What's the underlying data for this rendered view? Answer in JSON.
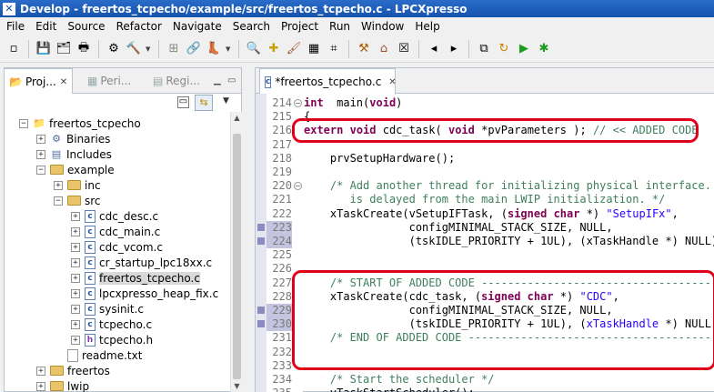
{
  "window": {
    "title": "Develop - freertos_tcpecho/example/src/freertos_tcpecho.c - LPCXpresso"
  },
  "menu": [
    "File",
    "Edit",
    "Source",
    "Refactor",
    "Navigate",
    "Search",
    "Project",
    "Run",
    "Window",
    "Help"
  ],
  "toolbar_icons": [
    "new-icon",
    "save-icon",
    "save-all-icon",
    "print-icon",
    "gear-icon",
    "hammer-icon",
    "binary-icon",
    "link-icon",
    "boot-icon",
    "search-icon",
    "new-project-icon",
    "brush-icon",
    "chip-icon",
    "xml-icon",
    "build-icon",
    "home-icon",
    "close-x-icon",
    "back-icon",
    "forward-icon",
    "copy-icon",
    "refresh-icon",
    "run-icon",
    "debug-icon"
  ],
  "left_panel": {
    "tabs": [
      {
        "label": "Proj...",
        "active": true
      },
      {
        "label": "Peri...",
        "active": false
      },
      {
        "label": "Regi...",
        "active": false
      }
    ],
    "tree": [
      {
        "label": "freertos_tcpecho",
        "depth": 0,
        "toggle": "-",
        "icon": "project"
      },
      {
        "label": "Binaries",
        "depth": 1,
        "toggle": "+",
        "icon": "binaries"
      },
      {
        "label": "Includes",
        "depth": 1,
        "toggle": "+",
        "icon": "includes"
      },
      {
        "label": "example",
        "depth": 1,
        "toggle": "-",
        "icon": "folder"
      },
      {
        "label": "inc",
        "depth": 2,
        "toggle": "+",
        "icon": "folder"
      },
      {
        "label": "src",
        "depth": 2,
        "toggle": "-",
        "icon": "folder"
      },
      {
        "label": "cdc_desc.c",
        "depth": 3,
        "toggle": "+",
        "icon": "c"
      },
      {
        "label": "cdc_main.c",
        "depth": 3,
        "toggle": "+",
        "icon": "c"
      },
      {
        "label": "cdc_vcom.c",
        "depth": 3,
        "toggle": "+",
        "icon": "c"
      },
      {
        "label": "cr_startup_lpc18xx.c",
        "depth": 3,
        "toggle": "+",
        "icon": "c"
      },
      {
        "label": "freertos_tcpecho.c",
        "depth": 3,
        "toggle": "+",
        "icon": "c",
        "selected": true
      },
      {
        "label": "lpcxpresso_heap_fix.c",
        "depth": 3,
        "toggle": "+",
        "icon": "c"
      },
      {
        "label": "sysinit.c",
        "depth": 3,
        "toggle": "+",
        "icon": "c"
      },
      {
        "label": "tcpecho.c",
        "depth": 3,
        "toggle": "+",
        "icon": "c"
      },
      {
        "label": "tcpecho.h",
        "depth": 3,
        "toggle": "+",
        "icon": "h"
      },
      {
        "label": "readme.txt",
        "depth": 2,
        "toggle": "",
        "icon": "txt"
      },
      {
        "label": "freertos",
        "depth": 1,
        "toggle": "+",
        "icon": "folder"
      },
      {
        "label": "lwip",
        "depth": 1,
        "toggle": "+",
        "icon": "folder"
      }
    ]
  },
  "editor": {
    "tab": {
      "label": "*freertos_tcpecho.c"
    },
    "lines": [
      {
        "num": "214",
        "fold": "-",
        "changed": false,
        "parts": [
          [
            "kw",
            "int"
          ],
          [
            "",
            "  main("
          ],
          [
            "kw",
            "void"
          ],
          [
            "",
            ")"
          ]
        ]
      },
      {
        "num": "215",
        "fold": "",
        "changed": false,
        "parts": [
          [
            "",
            "{"
          ]
        ]
      },
      {
        "num": "216",
        "fold": "",
        "changed": false,
        "parts": [
          [
            "kw",
            "extern"
          ],
          [
            "",
            " "
          ],
          [
            "kw",
            "void"
          ],
          [
            "",
            " cdc_task( "
          ],
          [
            "kw",
            "void"
          ],
          [
            "",
            " *pvParameters ); "
          ],
          [
            "cm",
            "// << ADDED CODE"
          ]
        ]
      },
      {
        "num": "217",
        "fold": "",
        "changed": false,
        "parts": [
          [
            "",
            ""
          ]
        ]
      },
      {
        "num": "218",
        "fold": "",
        "changed": false,
        "parts": [
          [
            "",
            "    prvSetupHardware();"
          ]
        ]
      },
      {
        "num": "219",
        "fold": "",
        "changed": false,
        "parts": [
          [
            "",
            ""
          ]
        ]
      },
      {
        "num": "220",
        "fold": "-",
        "changed": false,
        "parts": [
          [
            "cm",
            "    /* Add another thread for initializing physical interface. Th"
          ]
        ]
      },
      {
        "num": "221",
        "fold": "",
        "changed": false,
        "parts": [
          [
            "cm",
            "       is delayed from the main LWIP initialization. */"
          ]
        ]
      },
      {
        "num": "222",
        "fold": "",
        "changed": false,
        "parts": [
          [
            "",
            "    xTaskCreate(vSetupIFTask, ("
          ],
          [
            "kw",
            "signed"
          ],
          [
            "",
            " "
          ],
          [
            "kw",
            "char"
          ],
          [
            "",
            " *) "
          ],
          [
            "st",
            "\"SetupIFx\""
          ],
          [
            "",
            ","
          ]
        ]
      },
      {
        "num": "223",
        "fold": "",
        "changed": true,
        "parts": [
          [
            "",
            "                configMINIMAL_STACK_SIZE, NULL,"
          ]
        ]
      },
      {
        "num": "224",
        "fold": "",
        "changed": true,
        "parts": [
          [
            "",
            "                (tskIDLE_PRIORITY + 1UL), (xTaskHandle *) NULL);"
          ]
        ]
      },
      {
        "num": "225",
        "fold": "",
        "changed": false,
        "parts": [
          [
            "",
            ""
          ]
        ]
      },
      {
        "num": "226",
        "fold": "",
        "changed": false,
        "parts": [
          [
            "",
            ""
          ]
        ]
      },
      {
        "num": "227",
        "fold": "",
        "changed": false,
        "parts": [
          [
            "cm",
            "    /* START OF ADDED CODE -----------------------------------------"
          ]
        ]
      },
      {
        "num": "228",
        "fold": "",
        "changed": false,
        "parts": [
          [
            "",
            "    xTaskCreate(cdc_task, ("
          ],
          [
            "kw",
            "signed"
          ],
          [
            "",
            " "
          ],
          [
            "kw",
            "char"
          ],
          [
            "",
            " *) "
          ],
          [
            "st",
            "\"CDC\""
          ],
          [
            "",
            ","
          ]
        ]
      },
      {
        "num": "229",
        "fold": "",
        "changed": true,
        "parts": [
          [
            "",
            "                configMINIMAL_STACK_SIZE, NULL,"
          ]
        ]
      },
      {
        "num": "230",
        "fold": "",
        "changed": true,
        "parts": [
          [
            "",
            "                (tskIDLE_PRIORITY + 1UL), ("
          ],
          [
            "mac",
            "xTaskHandle"
          ],
          [
            "",
            " *) NULL);"
          ]
        ]
      },
      {
        "num": "231",
        "fold": "",
        "changed": false,
        "parts": [
          [
            "cm",
            "    /* END OF ADDED CODE -------------------------------------------"
          ]
        ]
      },
      {
        "num": "232",
        "fold": "",
        "changed": false,
        "parts": [
          [
            "",
            ""
          ]
        ]
      },
      {
        "num": "233",
        "fold": "",
        "changed": false,
        "parts": [
          [
            "",
            ""
          ]
        ]
      },
      {
        "num": "234",
        "fold": "",
        "changed": false,
        "parts": [
          [
            "cm",
            "    /* Start the scheduler */"
          ]
        ]
      },
      {
        "num": "235",
        "fold": "",
        "changed": false,
        "parts": [
          [
            "",
            "    vTaskStartScheduler();"
          ]
        ]
      }
    ]
  },
  "colors": {
    "annotation": "#e0001a",
    "keyword": "#7f0055",
    "comment": "#3f7f5f",
    "string": "#2a00ff",
    "title_bar": "#1f5fbd"
  }
}
